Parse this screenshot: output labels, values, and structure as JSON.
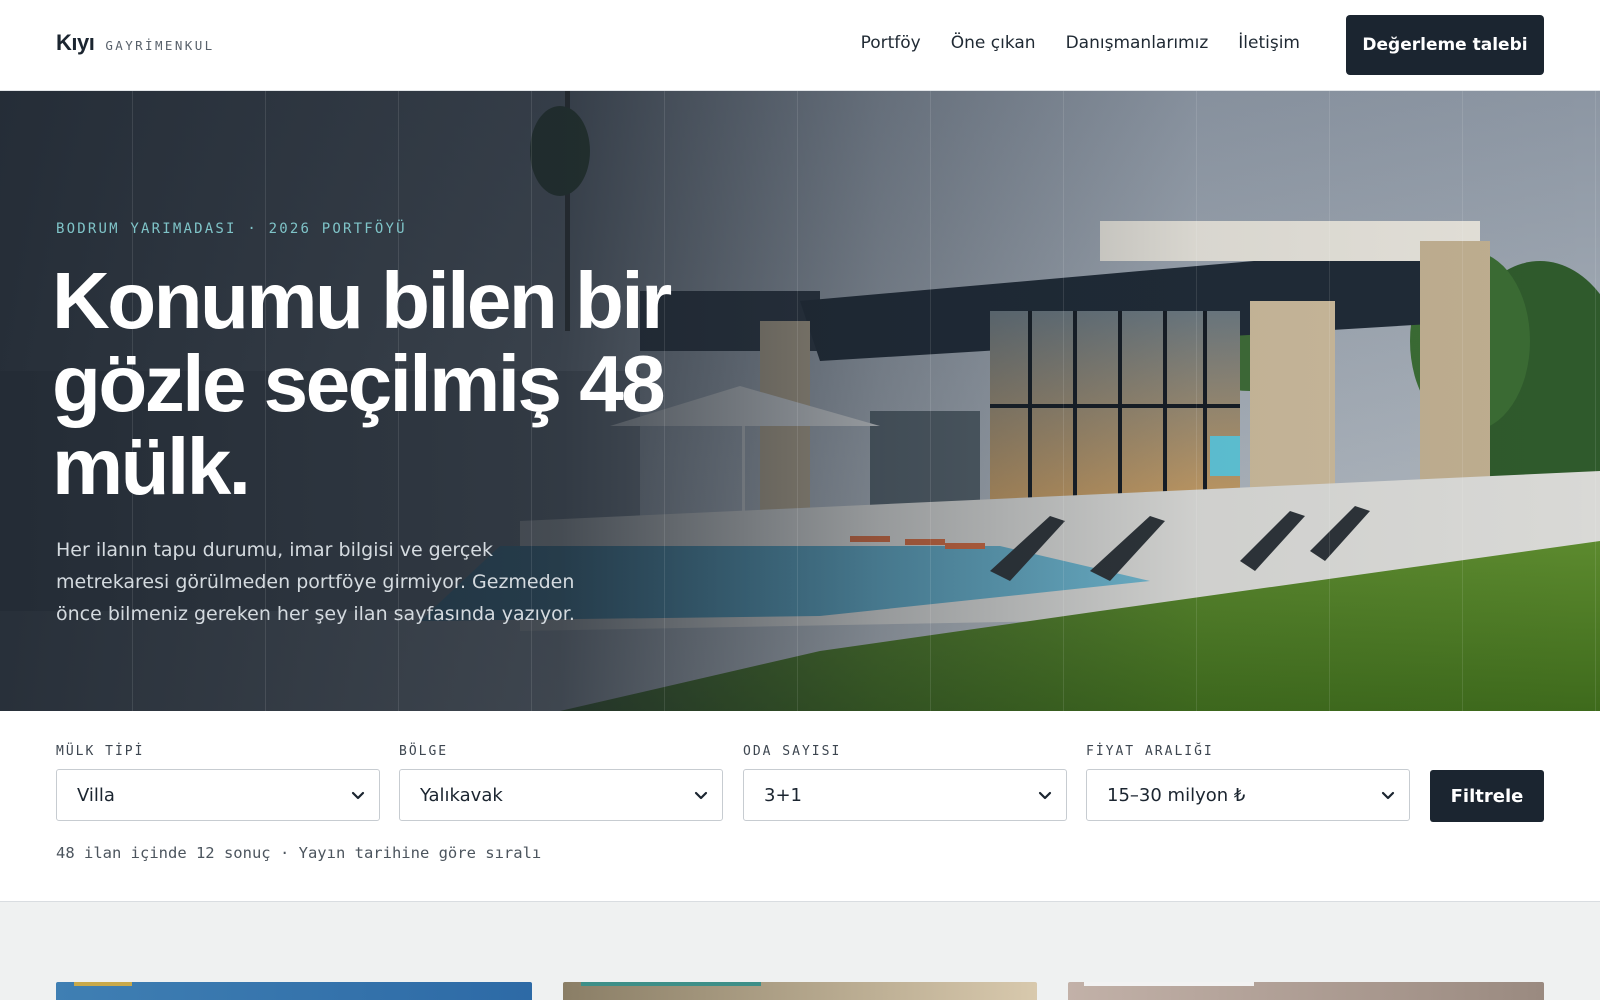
{
  "header": {
    "brand_name": "Kıyı",
    "brand_sub": "GAYRİMENKUL",
    "nav": [
      "Portföy",
      "Öne çıkan",
      "Danışmanlarımız",
      "İletişim"
    ],
    "cta_label": "Değerleme talebi"
  },
  "hero": {
    "eyebrow": "BODRUM YARIMADASI · 2026 PORTFÖYÜ",
    "title": "Konumu bilen bir gözle seçilmiş 48 mülk.",
    "description": "Her ilanın tapu durumu, imar bilgisi ve gerçek metrekaresi görülmeden portföye girmiyor. Gezmeden önce bilmeniz gereken her şey ilan sayfasında yazıyor."
  },
  "filters": {
    "fields": [
      {
        "label": "MÜLK TİPİ",
        "value": "Villa"
      },
      {
        "label": "BÖLGE",
        "value": "Yalıkavak"
      },
      {
        "label": "ODA SAYISI",
        "value": "3+1"
      },
      {
        "label": "FİYAT ARALIĞI",
        "value": "15–30 milyon ₺"
      }
    ],
    "button_label": "Filtrele",
    "results_text": "48 ilan içinde 12 sonuç · Yayın tarihine göre sıralı"
  },
  "colors": {
    "primary": "#1b2530",
    "accent": "#7fc4c8",
    "listing_bg": "#eff1f1"
  },
  "icons": {
    "select_arrow": "chevron-down-icon"
  }
}
